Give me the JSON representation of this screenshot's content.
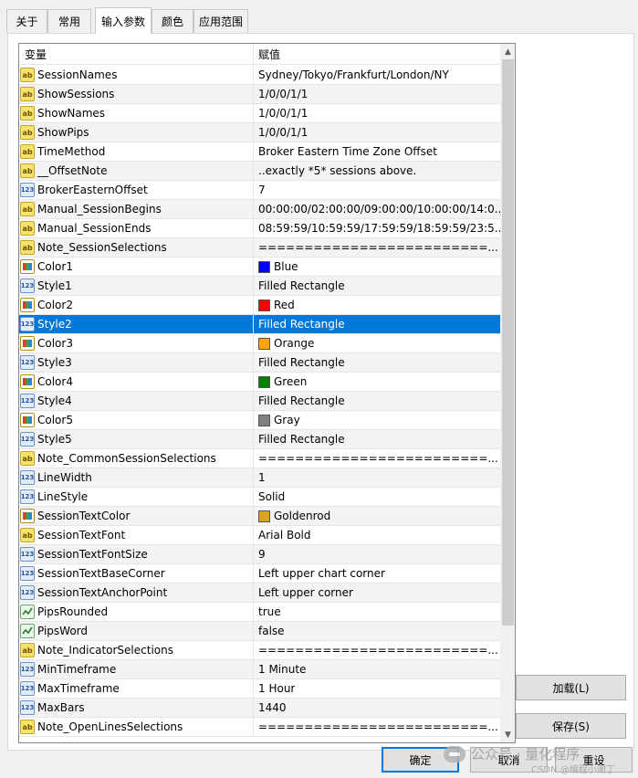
{
  "tabs": [
    "关于",
    "常用",
    "输入参数",
    "颜色",
    "应用范围"
  ],
  "active_tab": "输入参数",
  "table": {
    "header_variable": "变量",
    "header_value": "赋值",
    "rows": [
      {
        "type": "ab",
        "name": "SessionNames",
        "value": "Sydney/Tokyo/Frankfurt/London/NY"
      },
      {
        "type": "ab",
        "name": "ShowSessions",
        "value": "1/0/0/1/1"
      },
      {
        "type": "ab",
        "name": "ShowNames",
        "value": "1/0/0/1/1"
      },
      {
        "type": "ab",
        "name": "ShowPips",
        "value": "1/0/0/1/1"
      },
      {
        "type": "ab",
        "name": "TimeMethod",
        "value": "Broker Eastern Time Zone Offset"
      },
      {
        "type": "ab",
        "name": "__OffsetNote",
        "value": "..exactly *5* sessions above."
      },
      {
        "type": "num",
        "name": "BrokerEasternOffset",
        "value": "7"
      },
      {
        "type": "ab",
        "name": "Manual_SessionBegins",
        "value": "00:00:00/02:00:00/09:00:00/10:00:00/14:0..."
      },
      {
        "type": "ab",
        "name": "Manual_SessionEnds",
        "value": "08:59:59/10:59:59/17:59:59/18:59:59/23:5..."
      },
      {
        "type": "ab",
        "name": "Note_SessionSelections",
        "value": "=========================..."
      },
      {
        "type": "color",
        "name": "Color1",
        "value": "Blue",
        "swatch": "#0000ff"
      },
      {
        "type": "num",
        "name": "Style1",
        "value": "Filled Rectangle"
      },
      {
        "type": "color",
        "name": "Color2",
        "value": "Red",
        "swatch": "#ff0000"
      },
      {
        "type": "num",
        "name": "Style2",
        "value": "Filled Rectangle",
        "selected": true
      },
      {
        "type": "color",
        "name": "Color3",
        "value": "Orange",
        "swatch": "#ffa500"
      },
      {
        "type": "num",
        "name": "Style3",
        "value": "Filled Rectangle"
      },
      {
        "type": "color",
        "name": "Color4",
        "value": "Green",
        "swatch": "#008000"
      },
      {
        "type": "num",
        "name": "Style4",
        "value": "Filled Rectangle"
      },
      {
        "type": "color",
        "name": "Color5",
        "value": "Gray",
        "swatch": "#808080"
      },
      {
        "type": "num",
        "name": "Style5",
        "value": "Filled Rectangle"
      },
      {
        "type": "ab",
        "name": "Note_CommonSessionSelections",
        "value": "=========================..."
      },
      {
        "type": "num",
        "name": "LineWidth",
        "value": "1"
      },
      {
        "type": "num",
        "name": "LineStyle",
        "value": "Solid"
      },
      {
        "type": "color",
        "name": "SessionTextColor",
        "value": "Goldenrod",
        "swatch": "#daa520"
      },
      {
        "type": "ab",
        "name": "SessionTextFont",
        "value": "Arial Bold"
      },
      {
        "type": "num",
        "name": "SessionTextFontSize",
        "value": "9"
      },
      {
        "type": "num",
        "name": "SessionTextBaseCorner",
        "value": "Left upper chart corner"
      },
      {
        "type": "num",
        "name": "SessionTextAnchorPoint",
        "value": "Left upper corner"
      },
      {
        "type": "bool",
        "name": "PipsRounded",
        "value": "true"
      },
      {
        "type": "bool",
        "name": "PipsWord",
        "value": "false"
      },
      {
        "type": "ab",
        "name": "Note_IndicatorSelections",
        "value": "=========================..."
      },
      {
        "type": "num",
        "name": "MinTimeframe",
        "value": "1 Minute"
      },
      {
        "type": "num",
        "name": "MaxTimeframe",
        "value": "1 Hour"
      },
      {
        "type": "num",
        "name": "MaxBars",
        "value": "1440"
      },
      {
        "type": "ab",
        "name": "Note_OpenLinesSelections",
        "value": "=========================..."
      }
    ]
  },
  "icon_labels": {
    "ab": "ab",
    "num": "123"
  },
  "buttons": {
    "load": "加载(L)",
    "save": "保存(S)",
    "ok": "确定",
    "cancel": "取消",
    "reset": "重设"
  },
  "watermark": {
    "main": "公众号 · 量化程序",
    "sub": "CSDN @编程小谢丁"
  }
}
